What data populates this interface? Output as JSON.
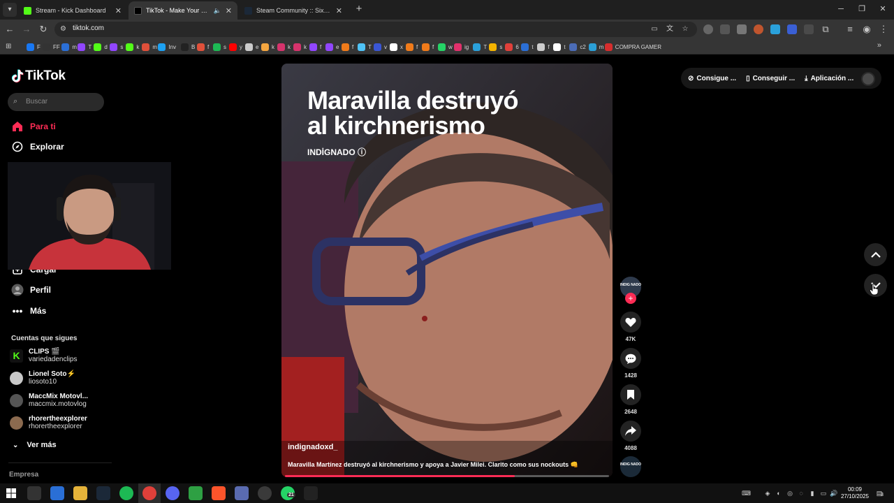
{
  "browser": {
    "tabs": [
      {
        "title": "Stream - Kick Dashboard",
        "active": false,
        "color": "#53fc18"
      },
      {
        "title": "TikTok - Make Your Day",
        "active": true,
        "color": "#ffffff"
      },
      {
        "title": "Steam Community :: Sixbullets",
        "active": false,
        "color": "#66c0f4"
      }
    ],
    "url": "tiktok.com",
    "bookmarks": [
      {
        "label": "F",
        "color": "#1877f2"
      },
      {
        "label": "FF",
        "color": "#333333"
      },
      {
        "label": "m",
        "color": "#2b6fd6"
      },
      {
        "label": "T",
        "color": "#9146ff"
      },
      {
        "label": "d",
        "color": "#53fc18"
      },
      {
        "label": "s",
        "color": "#9146ff"
      },
      {
        "label": "k",
        "color": "#53fc18"
      },
      {
        "label": "m",
        "color": "#e0503a"
      },
      {
        "label": "Inv",
        "color": "#1da1f2"
      },
      {
        "label": "B",
        "color": "#222222"
      },
      {
        "label": "f",
        "color": "#e0503a"
      },
      {
        "label": "s",
        "color": "#1db954"
      },
      {
        "label": "y",
        "color": "#ff0000"
      },
      {
        "label": "e",
        "color": "#cccccc"
      },
      {
        "label": "k",
        "color": "#f4a640"
      },
      {
        "label": "k",
        "color": "#d6336c"
      },
      {
        "label": "k",
        "color": "#d6336c"
      },
      {
        "label": "f",
        "color": "#9146ff"
      },
      {
        "label": "e",
        "color": "#9146ff"
      },
      {
        "label": "f",
        "color": "#f07b1a"
      },
      {
        "label": "T",
        "color": "#4fc3f7"
      },
      {
        "label": "v",
        "color": "#3a56d4"
      },
      {
        "label": "x",
        "color": "#ffffff"
      },
      {
        "label": "f",
        "color": "#f07b1a"
      },
      {
        "label": "f",
        "color": "#f07b1a"
      },
      {
        "label": "w",
        "color": "#25d366"
      },
      {
        "label": "ig",
        "color": "#e1306c"
      },
      {
        "label": "T",
        "color": "#2aa1db"
      },
      {
        "label": "s",
        "color": "#f4b400"
      },
      {
        "label": "6",
        "color": "#e0403a"
      },
      {
        "label": "t",
        "color": "#2b6fd6"
      },
      {
        "label": "f",
        "color": "#cccccc"
      },
      {
        "label": "t",
        "color": "#ffffff"
      },
      {
        "label": "c2",
        "color": "#4b6cb7"
      },
      {
        "label": "m",
        "color": "#2b9fd6"
      },
      {
        "label": "COMPRA GAMER",
        "color": "#d62d2d"
      }
    ]
  },
  "sidebar": {
    "logo": "TikTok",
    "search_placeholder": "Buscar",
    "nav": [
      {
        "label": "Para ti",
        "icon": "home-icon",
        "active": true
      },
      {
        "label": "Explorar",
        "icon": "compass-icon",
        "active": false
      },
      {
        "label": "Cargar",
        "icon": "upload-icon",
        "active": false
      },
      {
        "label": "Perfil",
        "icon": "profile-icon",
        "active": false
      },
      {
        "label": "Más",
        "icon": "more-icon",
        "active": false
      }
    ],
    "following_title": "Cuentas que sigues",
    "following": [
      {
        "name": "CLIPS 🎬",
        "handle": "variedadenclips",
        "color": "#53fc18"
      },
      {
        "name": "Lionel Soto⚡",
        "handle": "liosoto10",
        "color": "#c9c9c9"
      },
      {
        "name": "MaccMix Motovl...",
        "handle": "maccmix.motovlog",
        "color": "#555555"
      },
      {
        "name": "rhorertheexplorer",
        "handle": "rhorertheexplorer",
        "color": "#8b6a4f"
      }
    ],
    "see_more": "Ver más",
    "company": "Empresa"
  },
  "video": {
    "headline_line1": "Maravilla destruyó",
    "headline_line2": "al kirchnerismo",
    "brand": "INDİGNADO ⓘ",
    "author": "indignadoxd_",
    "caption": "Maravilla Martínez destruyó al kirchnerismo y apoya a Javier Milei. Clarito como sus nockouts 👊",
    "progress": 0.71,
    "account_avatar_text": "INDIG NADO",
    "likes": "47K",
    "comments": "1428",
    "saves": "2648",
    "shares": "4088",
    "music_avatar_text": "INDIG NADO"
  },
  "header": {
    "coins": "Consigue ...",
    "get": "Conseguir ...",
    "app": "Aplicación ..."
  },
  "taskbar": {
    "time": "00:09",
    "date": "27/10/2025",
    "whatsapp_badge": "21",
    "notif_badge": "3"
  }
}
